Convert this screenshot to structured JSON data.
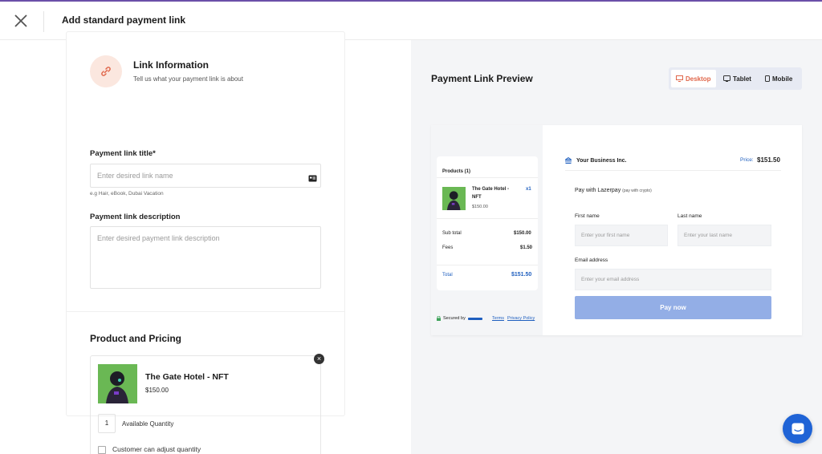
{
  "topbar": {
    "title": "Add standard payment link"
  },
  "link_info": {
    "title": "Link Information",
    "subtitle": "Tell us what your payment link is about",
    "title_label": "Payment link title*",
    "title_placeholder": "Enter desired link name",
    "title_hint": "e.g Hair, eBook, Dubai Vacation",
    "description_label": "Payment link description",
    "description_placeholder": "Enter desired payment link description"
  },
  "pricing": {
    "title": "Product and Pricing",
    "product_name": "The Gate Hotel - NFT",
    "product_price": "$150.00",
    "quantity": "1",
    "quantity_label": "Available Quantity",
    "adjust_label": "Customer can adjust quantity"
  },
  "preview": {
    "title": "Payment Link Preview",
    "devices": [
      "Desktop",
      "Tablet",
      "Mobile"
    ],
    "active_device": "Desktop",
    "products_header": "Products (1)",
    "item_name_line1": "The Gate Hotel -",
    "item_name_line2": "NFT",
    "item_qty": "x1",
    "item_price": "$150.00",
    "subtotal_label": "Sub total",
    "subtotal_value": "$150.00",
    "fees_label": "Fees",
    "fees_value": "$1.50",
    "total_label": "Total",
    "total_value": "$151.50",
    "secured_by": "Secured by",
    "terms": "Terms",
    "privacy": "Privacy Policy",
    "business_name": "Your Business Inc.",
    "price_label": "Price:",
    "price_value": "$151.50",
    "pay_with": "Pay with Lazerpay",
    "pay_with_sub": "(pay with crypto)",
    "first_name_label": "First name",
    "first_name_placeholder": "Enter your first name",
    "last_name_label": "Last name",
    "last_name_placeholder": "Enter your last name",
    "email_label": "Email address",
    "email_placeholder": "Enter your email address",
    "pay_button": "Pay now"
  },
  "colors": {
    "accent": "#e0664a",
    "link_blue": "#1f5fbf",
    "pay_button": "#93aee6",
    "chat_button": "#1f63d6",
    "top_border": "#6b4fa8"
  }
}
